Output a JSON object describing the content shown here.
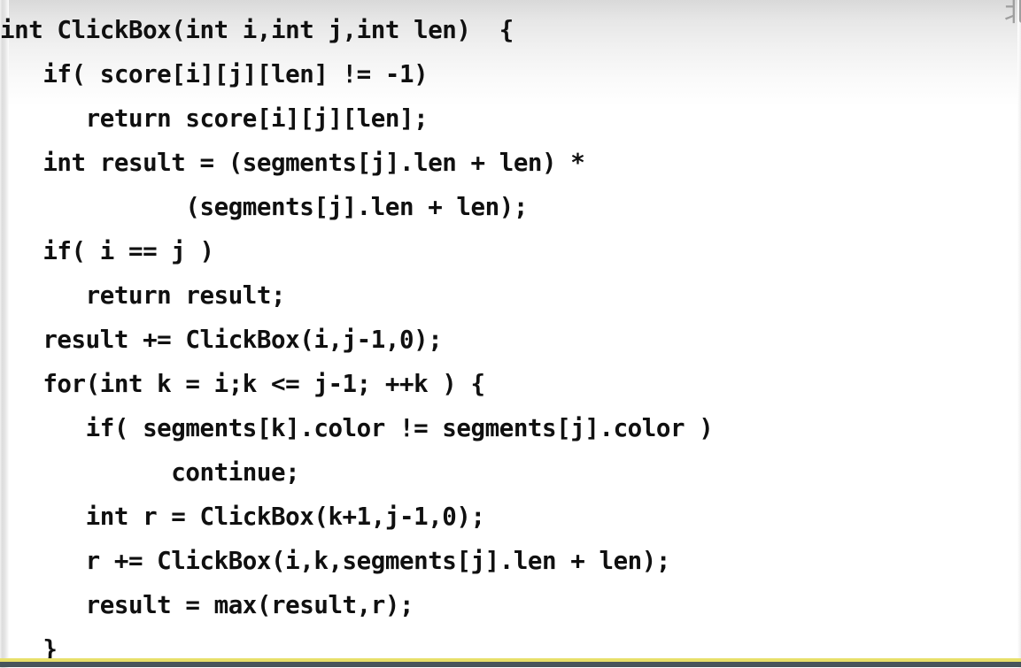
{
  "slide": {
    "kind": "code-presentation-slide",
    "background_color": "#ffffff",
    "text_color": "#101010",
    "accent_rule_color": "#e8e06a",
    "base_rule_color": "#47555b",
    "top_gradient_color": "#d9d9d9",
    "corner_glyph": "北",
    "corner_glyph_color": "#9b9b9b"
  },
  "code": {
    "language": "cpp",
    "function_name": "ClickBox",
    "lines": [
      "int ClickBox(int i,int j,int len)  {",
      "   if( score[i][j][len] != -1)",
      "      return score[i][j][len];",
      "   int result = (segments[j].len + len) *",
      "             (segments[j].len + len);",
      "   if( i == j )",
      "      return result;",
      "   result += ClickBox(i,j-1,0);",
      "   for(int k = i;k <= j-1; ++k ) {",
      "      if( segments[k].color != segments[j].color )",
      "            continue;",
      "      int r = ClickBox(k+1,j-1,0);",
      "      r += ClickBox(i,k,segments[j].len + len);",
      "      result = max(result,r);",
      "   }"
    ]
  }
}
